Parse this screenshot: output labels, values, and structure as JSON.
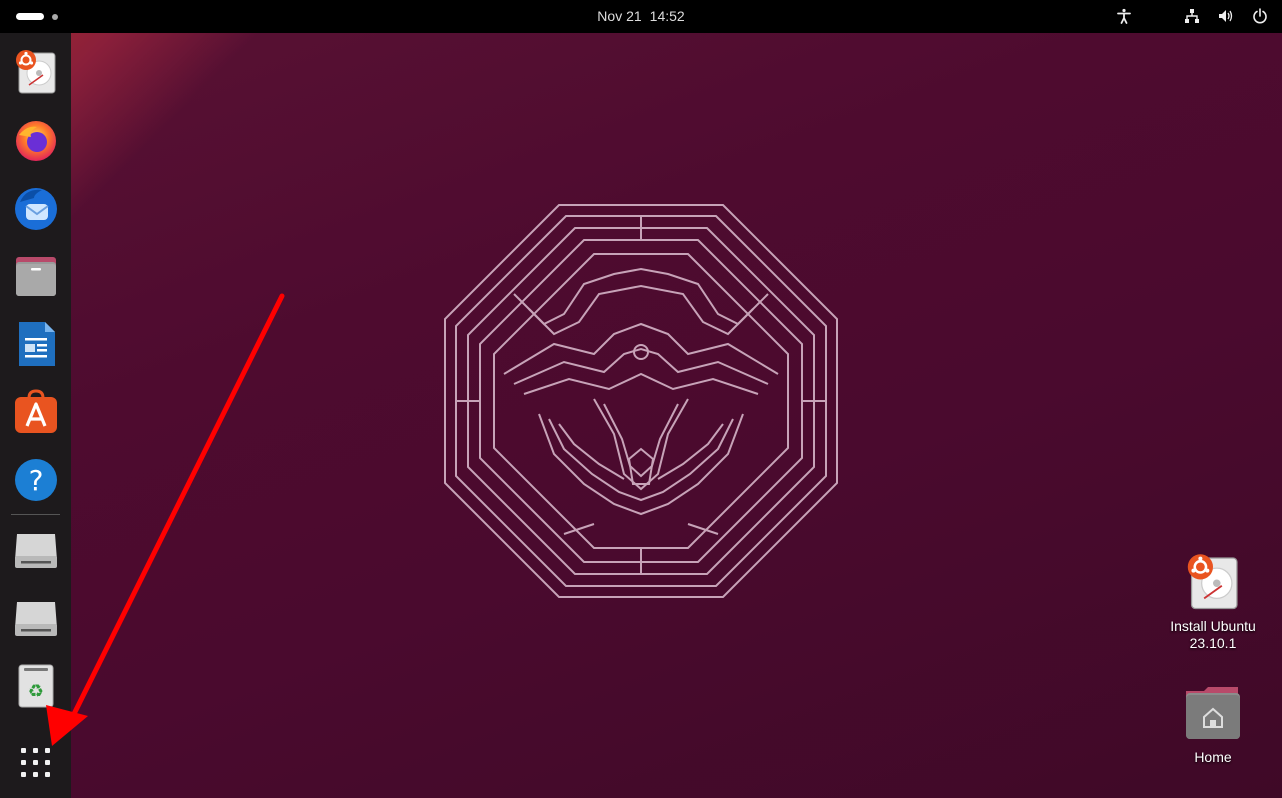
{
  "topbar": {
    "date": "Nov 21",
    "time": "14:52",
    "tray_icons": [
      "accessibility-icon",
      "network-icon",
      "volume-icon",
      "power-icon"
    ]
  },
  "dock": {
    "items": [
      {
        "name": "install-ubuntu",
        "icon": "installer-disk-icon"
      },
      {
        "name": "firefox",
        "icon": "firefox-icon"
      },
      {
        "name": "thunderbird",
        "icon": "thunderbird-icon"
      },
      {
        "name": "files",
        "icon": "files-icon"
      },
      {
        "name": "libreoffice-writer",
        "icon": "writer-icon"
      },
      {
        "name": "app-center",
        "icon": "app-center-icon"
      },
      {
        "name": "help",
        "icon": "help-icon"
      },
      {
        "name": "drive-1",
        "icon": "drive-icon"
      },
      {
        "name": "drive-2",
        "icon": "drive-icon"
      },
      {
        "name": "trash",
        "icon": "trash-icon"
      },
      {
        "name": "show-apps",
        "icon": "app-grid-icon"
      }
    ],
    "help_glyph": "?"
  },
  "desktop": {
    "icons": [
      {
        "label_line1": "Install Ubuntu",
        "label_line2": "23.10.1",
        "icon": "installer-disk-icon"
      },
      {
        "label_line1": "Home",
        "icon": "home-folder-icon"
      }
    ]
  },
  "colors": {
    "topbar": "#000000",
    "dock": "#1d1a1c",
    "wallpaper": "#4e0b2f",
    "accent_orange": "#e95420",
    "annotation_arrow": "#ff0000"
  }
}
